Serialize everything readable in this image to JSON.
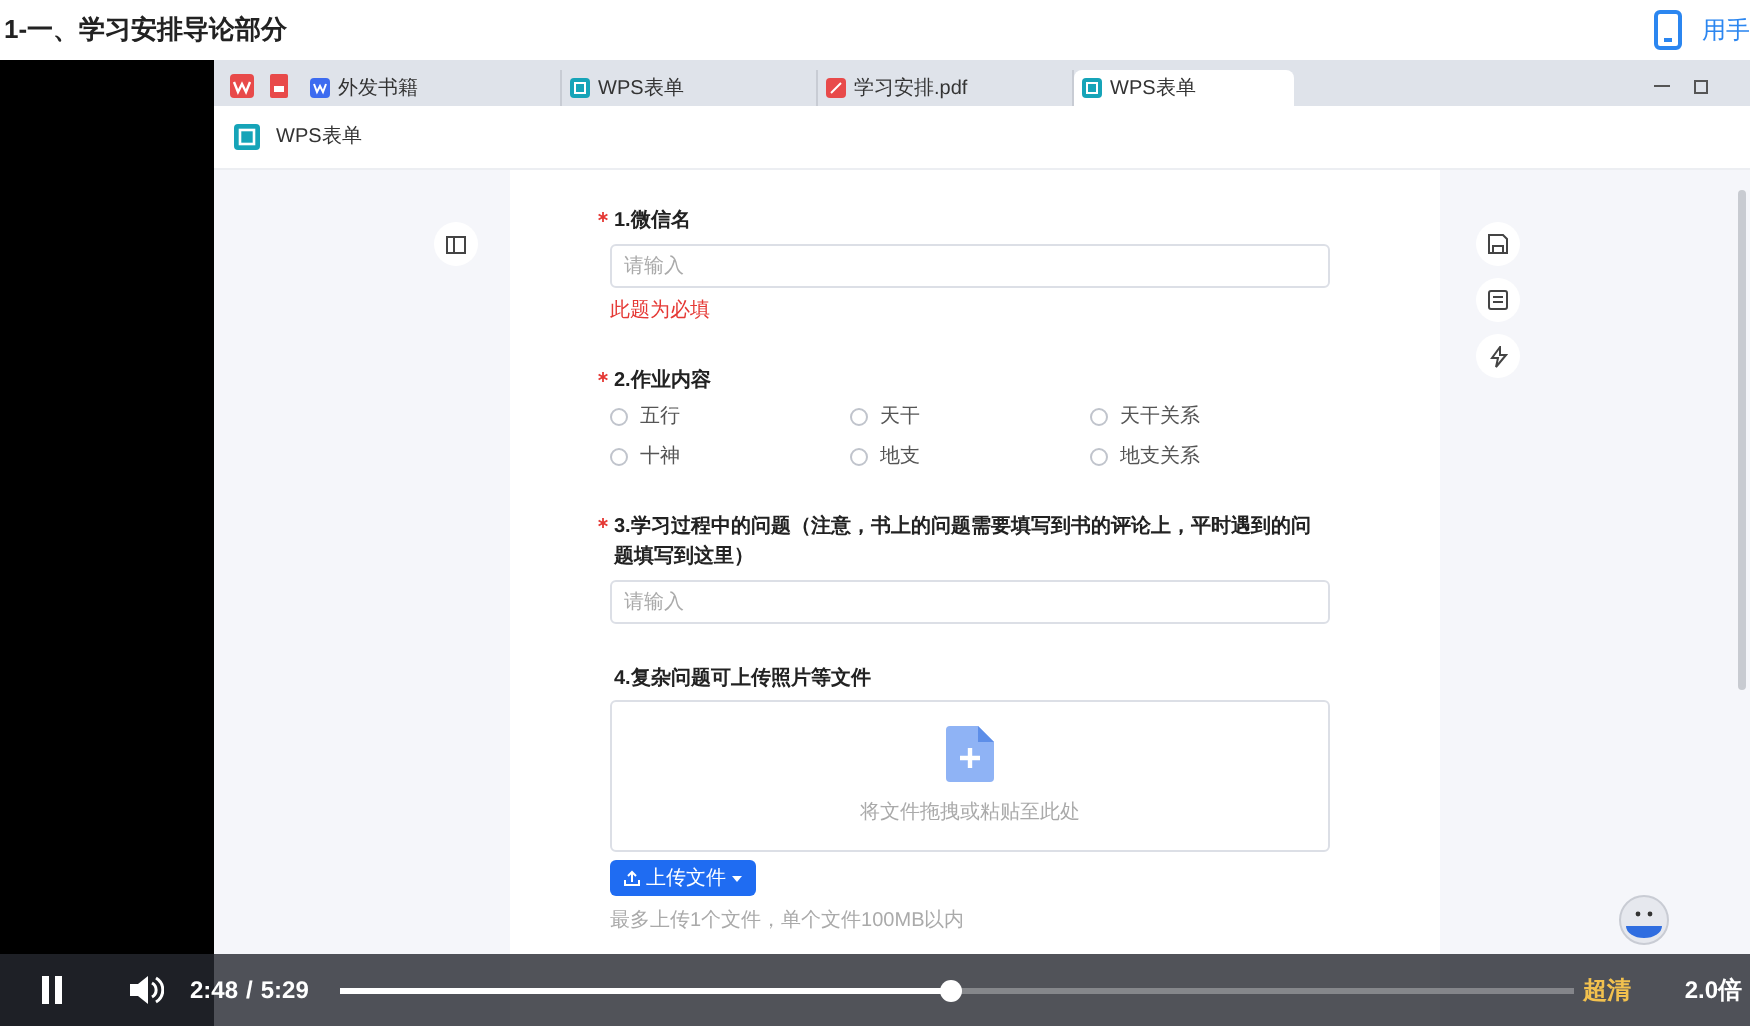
{
  "header": {
    "title": "1-一、学习安排导论部分",
    "phone_link": "用手"
  },
  "browser": {
    "tabs": [
      {
        "label": "外发书籍",
        "kind": "doc",
        "selected": false
      },
      {
        "label": "WPS表单",
        "kind": "form",
        "selected": false
      },
      {
        "label": "学习安排.pdf",
        "kind": "pdf",
        "selected": false
      },
      {
        "label": "WPS表单",
        "kind": "form",
        "selected": true
      }
    ]
  },
  "app": {
    "title": "WPS表单"
  },
  "form": {
    "questions": [
      {
        "kind": "text",
        "label": "1.微信名",
        "required": true,
        "placeholder": "请输入",
        "error": "此题为必填"
      },
      {
        "kind": "choice",
        "label": "2.作业内容",
        "required": true,
        "options": [
          {
            "label": "五行",
            "selected": false
          },
          {
            "label": "天干",
            "selected": false
          },
          {
            "label": "天干关系",
            "selected": false
          },
          {
            "label": "十神",
            "selected": false
          },
          {
            "label": "地支",
            "selected": false
          },
          {
            "label": "地支关系",
            "selected": false
          }
        ]
      },
      {
        "kind": "text",
        "label": "3.学习过程中的问题（注意，书上的问题需要填写到书的评论上，平时遇到的问题填写到这里）",
        "required": true,
        "placeholder": "请输入"
      },
      {
        "kind": "upload",
        "label": "4.复杂问题可上传照片等文件",
        "required": false,
        "drop_text": "将文件拖拽或粘贴至此处",
        "button": "上传文件",
        "hint": "最多上传1个文件，单个文件100MB以内"
      }
    ]
  },
  "player": {
    "playing": true,
    "current_time": "2:48",
    "separator": "/",
    "duration": "5:29",
    "level": 0.494,
    "quality": "超清",
    "speed": "2.0倍"
  }
}
